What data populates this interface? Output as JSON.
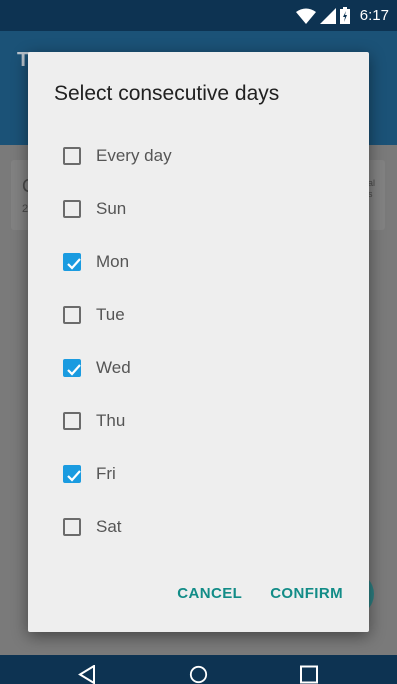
{
  "status_bar": {
    "time": "6:17"
  },
  "dialog": {
    "title": "Select consecutive days",
    "options": [
      {
        "label": "Every day",
        "checked": false
      },
      {
        "label": "Sun",
        "checked": false
      },
      {
        "label": "Mon",
        "checked": true
      },
      {
        "label": "Tue",
        "checked": false
      },
      {
        "label": "Wed",
        "checked": true
      },
      {
        "label": "Thu",
        "checked": false
      },
      {
        "label": "Fri",
        "checked": true
      },
      {
        "label": "Sat",
        "checked": false
      }
    ],
    "cancel_label": "CANCEL",
    "confirm_label": "CONFIRM"
  },
  "colors": {
    "accent": "#1a9be0",
    "button_text": "#128c87",
    "status_bar": "#0d3352",
    "app_bar": "#1b5277"
  }
}
